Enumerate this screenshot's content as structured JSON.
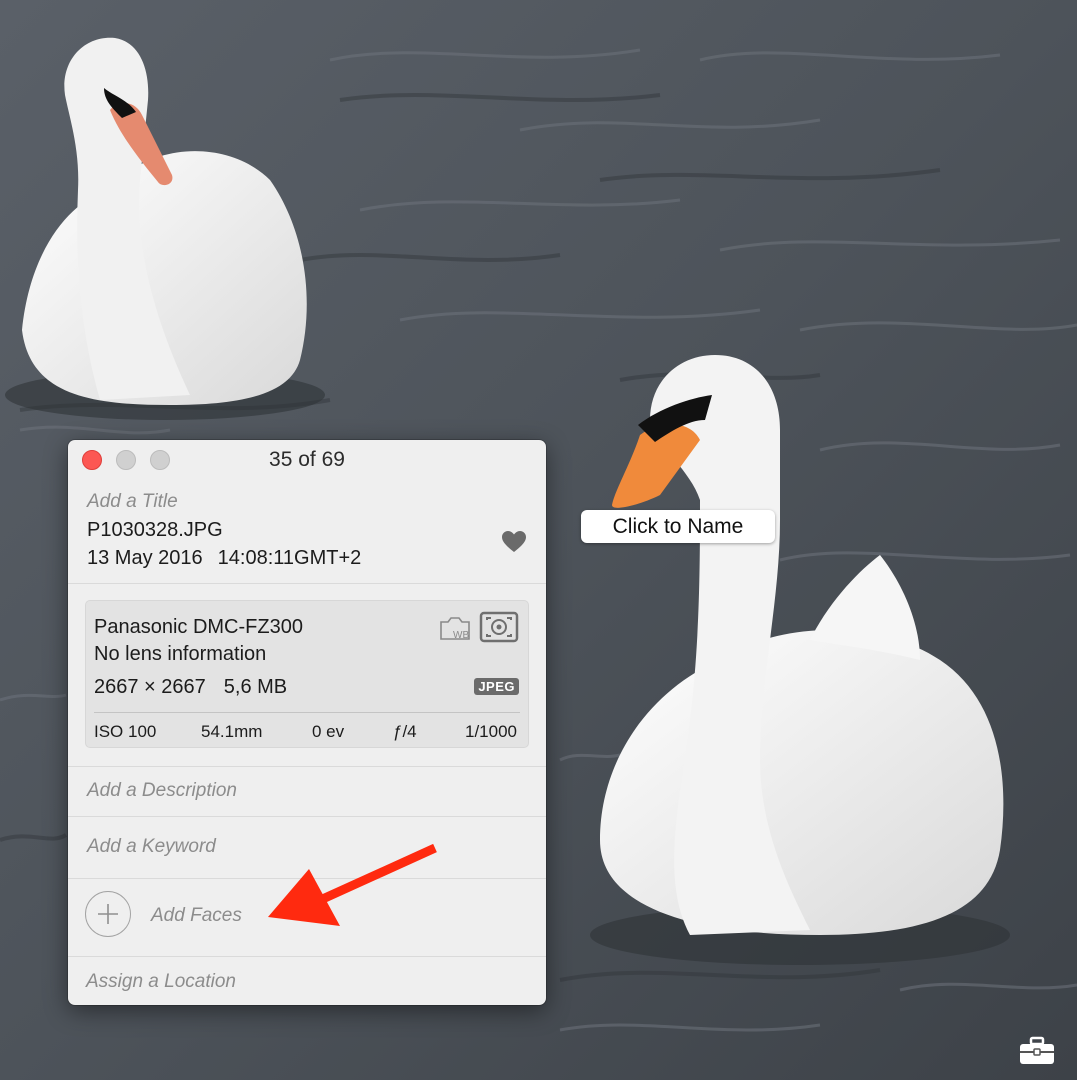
{
  "face_tag": {
    "label": "Click to Name"
  },
  "info_panel": {
    "counter": "35 of 69",
    "title_placeholder": "Add a Title",
    "filename": "P1030328.JPG",
    "date": "13 May 2016",
    "time": "14:08:11GMT+2",
    "exif": {
      "camera": "Panasonic DMC-FZ300",
      "lens": "No lens information",
      "dimensions": "2667 × 2667",
      "file_size": "5,6 MB",
      "format_badge": "JPEG",
      "iso": "ISO 100",
      "focal_length": "54.1mm",
      "exposure_comp": "0 ev",
      "aperture": "ƒ/4",
      "shutter": "1/1000"
    },
    "description_placeholder": "Add a Description",
    "keyword_placeholder": "Add a Keyword",
    "add_faces_label": "Add Faces",
    "location_placeholder": "Assign a Location"
  },
  "colors": {
    "close_button": "#fc5753",
    "annotation_arrow": "#ff2a0f",
    "panel_background": "#efefef"
  },
  "icons": [
    "close-icon",
    "heart-icon",
    "white-balance-icon",
    "metering-icon",
    "plus-icon",
    "toolbox-icon",
    "arrow-annotation"
  ]
}
